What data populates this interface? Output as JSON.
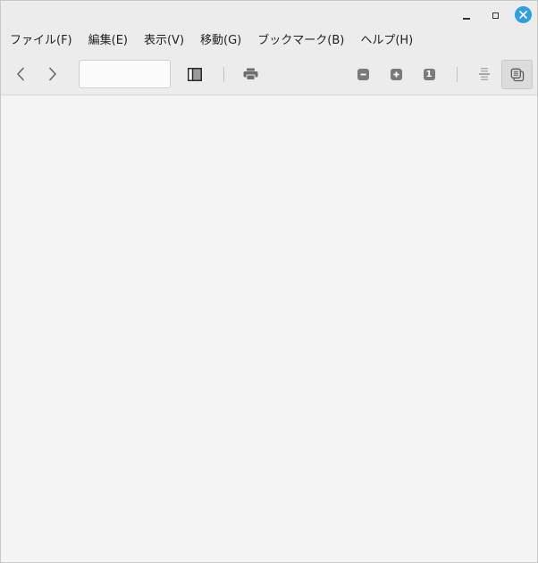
{
  "titlebar": {
    "minimize_icon": "minimize-icon",
    "maximize_icon": "maximize-icon",
    "close_icon": "close-icon",
    "close_color": "#2f9fe3"
  },
  "menubar": {
    "items": [
      {
        "label": "ファイル(F)"
      },
      {
        "label": "編集(E)"
      },
      {
        "label": "表示(V)"
      },
      {
        "label": "移動(G)"
      },
      {
        "label": "ブックマーク(B)"
      },
      {
        "label": "ヘルプ(H)"
      }
    ]
  },
  "toolbar": {
    "back_icon": "chevron-left-icon",
    "forward_icon": "chevron-right-icon",
    "page_entry": {
      "current_page": "",
      "page_count": ""
    },
    "sidebar_icon": "sidebar-toggle-icon",
    "print_icon": "printer-icon",
    "zoom_out_icon": "zoom-out-icon",
    "zoom_in_icon": "zoom-in-icon",
    "zoom_original_label": "1",
    "continuous_icon": "continuous-scroll-icon",
    "dual_page_icon": "dual-page-icon"
  },
  "document": {}
}
